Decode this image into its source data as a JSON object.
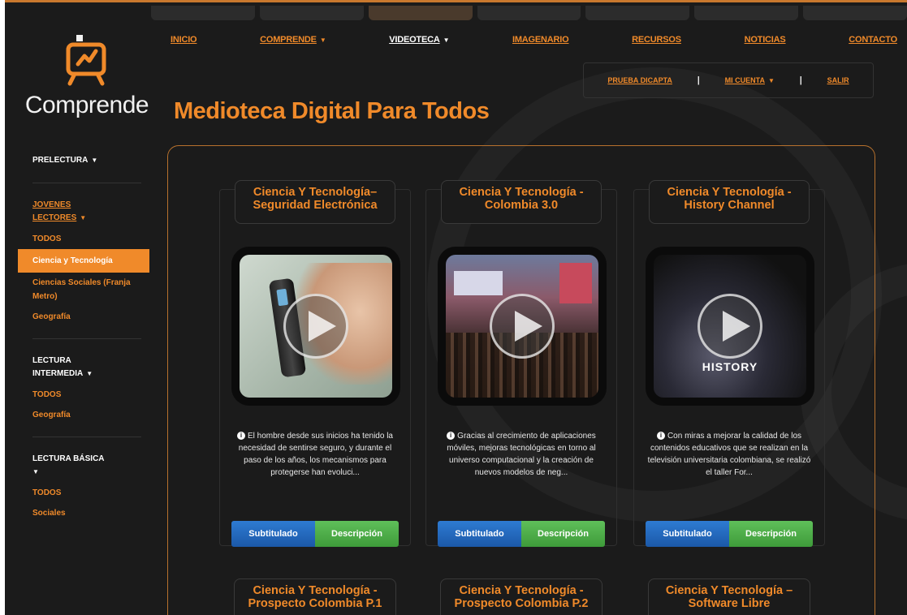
{
  "brand": {
    "name": "Comprende"
  },
  "nav": {
    "items": [
      {
        "label": "INICIO",
        "caret": false
      },
      {
        "label": "COMPRENDE",
        "caret": true
      },
      {
        "label": "VIDEOTECA",
        "caret": true,
        "current": true
      },
      {
        "label": "IMAGENARIO",
        "caret": false
      },
      {
        "label": "RECURSOS",
        "caret": false
      },
      {
        "label": "NOTICIAS",
        "caret": false
      },
      {
        "label": "CONTACTO",
        "caret": false
      }
    ],
    "caret_symbol": "▼"
  },
  "subnav": {
    "prueba": "PRUEBA DICAPTA",
    "sep": "|",
    "cuenta": "MI CUENTA",
    "salir": "SALIR"
  },
  "page_title": "Medioteca Digital Para Todos",
  "sidebar": {
    "prelectura": "PRELECTURA",
    "jovenes_line1": "JOVENES",
    "jovenes_line2": "LECTORES",
    "jovenes_items": [
      "TODOS",
      "Ciencia y Tecnología",
      "Ciencias Sociales (Franja Metro)",
      "Geografía"
    ],
    "intermedia_line1": "LECTURA",
    "intermedia_line2": "INTERMEDIA",
    "intermedia_items": [
      "TODOS",
      "Geografía"
    ],
    "basica": "LECTURA BÁSICA",
    "basica_items": [
      "TODOS",
      "Sociales"
    ]
  },
  "cards": [
    {
      "title": "Ciencia Y Tecnología– Seguridad Electrónica",
      "description": "El hombre desde sus inicios ha tenido la necesidad de sentirse seguro, y durante el paso de los años, los mecanismos para protegerse han evoluci...",
      "btn_sub": "Subtitulado",
      "btn_desc": "Descripción"
    },
    {
      "title": "Ciencia Y Tecnología - Colombia 3.0",
      "description": "Gracias al crecimiento de aplicaciones móviles, mejoras tecnológicas en torno al universo computacional y la creación de nuevos modelos de neg...",
      "btn_sub": "Subtitulado",
      "btn_desc": "Descripción"
    },
    {
      "title": "Ciencia Y Tecnología - History Channel",
      "description": "Con miras a mejorar la calidad de los contenidos educativos que se realizan en la televisión universitaria colombiana, se realizó el taller For...",
      "btn_sub": "Subtitulado",
      "btn_desc": "Descripción",
      "thumb_text": "HISTORY"
    }
  ],
  "cards_row2": [
    {
      "title": "Ciencia Y Tecnología - Prospecto Colombia P.1"
    },
    {
      "title": "Ciencia Y Tecnología - Prospecto Colombia P.2"
    },
    {
      "title": "Ciencia Y Tecnología – Software Libre"
    }
  ],
  "colors": {
    "accent": "#f08a2a",
    "background": "#1b1b1b",
    "blue_button": "#1b58a8",
    "green_button": "#3e9b3a"
  },
  "icons": [
    "logo-tv-icon",
    "caret-down-icon",
    "info-icon",
    "play-icon"
  ]
}
